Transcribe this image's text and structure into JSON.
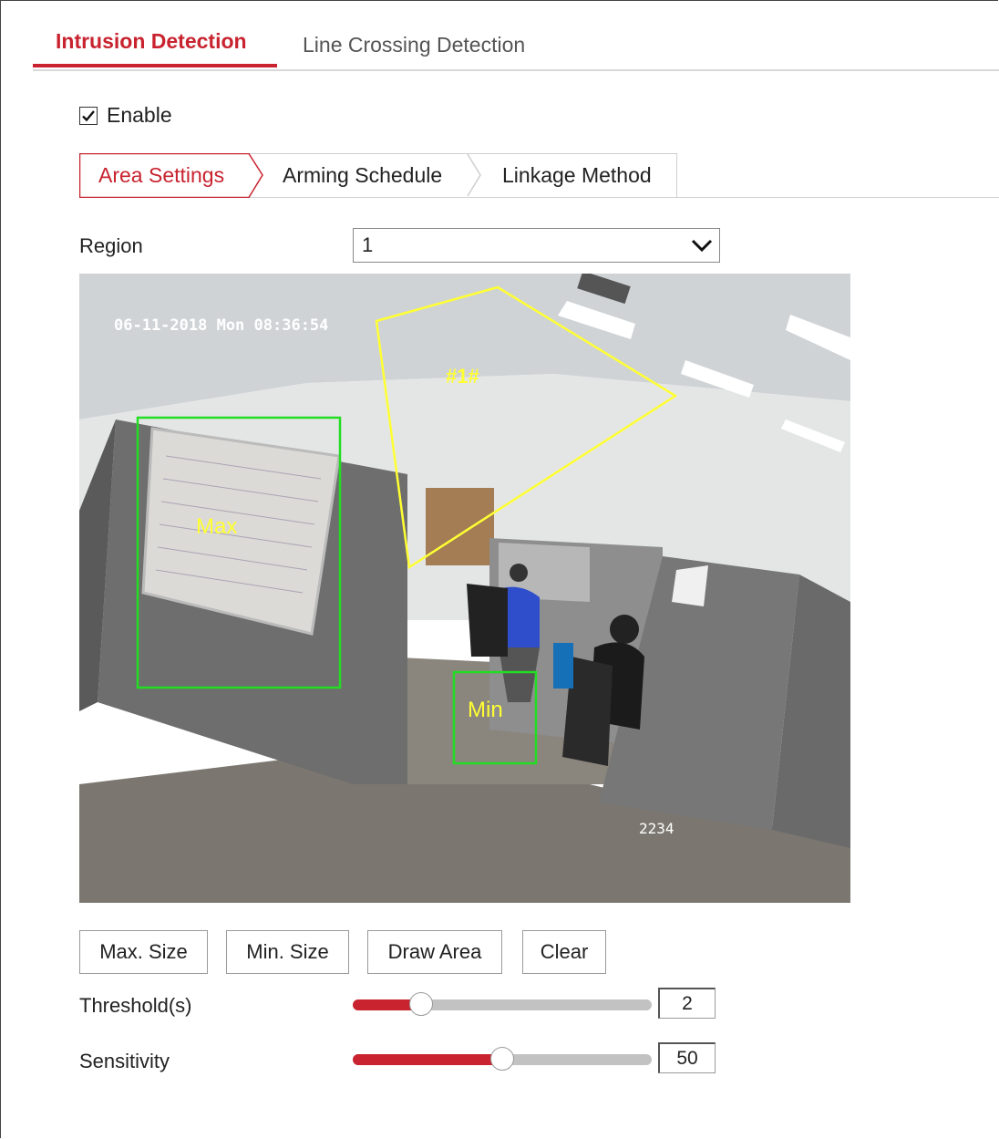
{
  "tabs": [
    "Intrusion Detection",
    "Line Crossing Detection"
  ],
  "enable": {
    "label": "Enable",
    "checked": true
  },
  "sub_tabs": [
    "Area Settings",
    "Arming Schedule",
    "Linkage Method"
  ],
  "region": {
    "label": "Region",
    "value": "1"
  },
  "video": {
    "timestamp": "06-11-2018 Mon 08:36:54",
    "camera_label": "2234",
    "region_label": "#1#",
    "max_label": "Max",
    "min_label": "Min"
  },
  "buttons": [
    "Max. Size",
    "Min. Size",
    "Draw Area",
    "Clear"
  ],
  "threshold": {
    "label": "Threshold(s)",
    "value": "2",
    "level": 0.23
  },
  "sensitivity": {
    "label": "Sensitivity",
    "value": "50",
    "level": 0.5
  },
  "colors": {
    "accent": "#c8232f",
    "region_outline": "#ffff33",
    "size_box": "#22dd22"
  }
}
